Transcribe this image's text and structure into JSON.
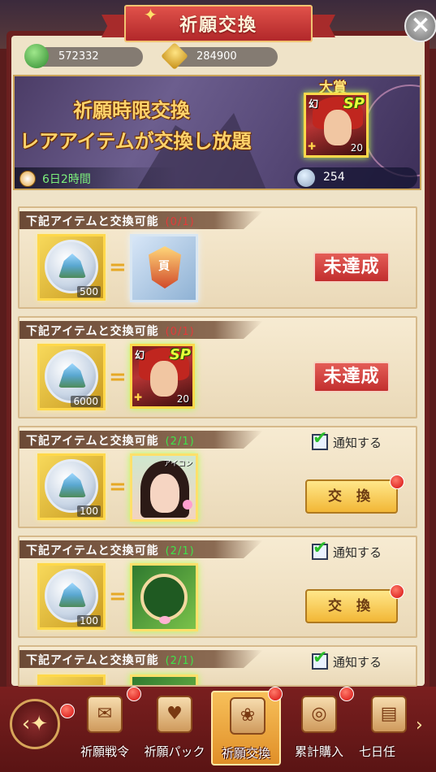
{
  "header": {
    "title": "祈願交換"
  },
  "currencies": [
    {
      "icon": "green-gem-icon",
      "value": "572332"
    },
    {
      "icon": "gold-gem-icon",
      "value": "284900"
    }
  ],
  "banner": {
    "line1": "祈願時限交換",
    "line2": "レアアイテムが交換し放題",
    "time_left": "6日2時間",
    "gem_count": "254",
    "prize_label": "大賞",
    "prize": {
      "grade": "幻",
      "tag": "SP",
      "count": "20"
    }
  },
  "rows": [
    {
      "header": "下記アイテムと交換可能",
      "limit": "(0/1)",
      "cost": "500",
      "target": "badge",
      "badge_text": "頁",
      "status": "未達成"
    },
    {
      "header": "下記アイテムと交換可能",
      "limit": "(0/1)",
      "cost": "6000",
      "target": "character",
      "grade": "幻",
      "tag": "SP",
      "count": "20",
      "status": "未達成"
    },
    {
      "header": "下記アイテムと交換可能",
      "limit": "(2/1)",
      "cost": "100",
      "target": "portrait",
      "portrait_label": "アイコン",
      "notify": "通知する",
      "button": "交 換"
    },
    {
      "header": "下記アイテムと交換可能",
      "limit": "(2/1)",
      "cost": "100",
      "target": "frame",
      "notify": "通知する",
      "button": "交 換"
    },
    {
      "header": "下記アイテムと交換可能",
      "limit": "(2/1)",
      "notify": "通知する"
    }
  ],
  "tabs": [
    {
      "label": "祈願戦令",
      "icon": "scroll-icon",
      "badge": true
    },
    {
      "label": "祈願パック",
      "icon": "pack-icon",
      "badge": false
    },
    {
      "label": "祈願交換",
      "icon": "rose-icon",
      "badge": true,
      "active": true
    },
    {
      "label": "累計購入",
      "icon": "coins-icon",
      "badge": true
    },
    {
      "label": "七日任",
      "icon": "cards-icon",
      "badge": false
    }
  ]
}
